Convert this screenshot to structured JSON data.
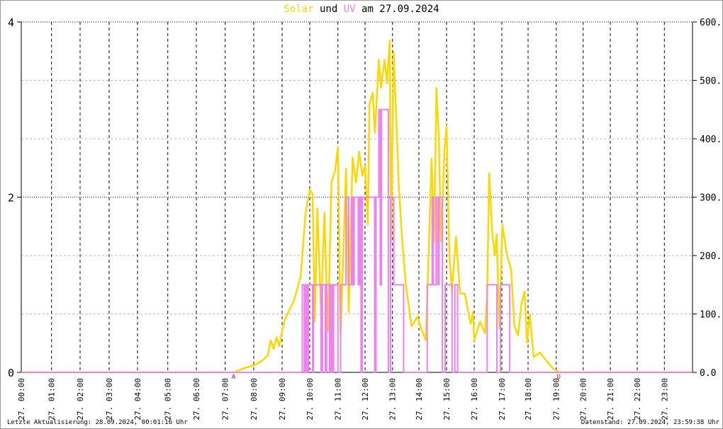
{
  "title": {
    "part1": "Solar",
    "part2": "und",
    "part3": "UV",
    "part4": "am 27.09.2024"
  },
  "footer": {
    "last_update": "Letzte Aktualisierung: 28.09.2024, 00:01:16 Uhr",
    "data_state": "Datenstand: 27.09.2024, 23:59:38 Uhr"
  },
  "colors": {
    "solar": "#FFD700",
    "uv": "#EE82EE",
    "marker": "#FF0000"
  },
  "chart_data": {
    "type": "line",
    "title": "Solar und UV am 27.09.2024",
    "x_unit": "hour of day",
    "xlim": [
      0,
      24
    ],
    "x_tick_labels": [
      "27. 00:00",
      "27. 01:00",
      "27. 02:00",
      "27. 03:00",
      "27. 04:00",
      "27. 05:00",
      "27. 06:00",
      "27. 07:00",
      "27. 08:00",
      "27. 09:00",
      "27. 10:00",
      "27. 11:00",
      "27. 12:00",
      "27. 13:00",
      "27. 14:00",
      "27. 15:00",
      "27. 16:00",
      "27. 17:00",
      "27. 18:00",
      "27. 19:00",
      "27. 20:00",
      "27. 21:00",
      "27. 22:00",
      "27. 23:00"
    ],
    "left_axis": {
      "label": "UV",
      "ylim": [
        0,
        4
      ],
      "tick_labels": [
        "4",
        "2",
        "0"
      ],
      "ticks": [
        4,
        2,
        0
      ]
    },
    "right_axis": {
      "label": "Solar",
      "ylim": [
        0,
        600
      ],
      "tick_labels": [
        "600.0",
        "500.0",
        "400.0",
        "300.0",
        "200.0",
        "100.0",
        "0.0"
      ],
      "ticks": [
        600,
        500,
        400,
        300,
        200,
        100,
        0
      ]
    },
    "grid": true,
    "markers": [
      {
        "label": "A",
        "hour": 7.3
      },
      {
        "label": "U",
        "hour": 19.1
      }
    ],
    "series": [
      {
        "name": "Solar",
        "axis": "right",
        "points": [
          [
            0,
            0
          ],
          [
            7.3,
            0
          ],
          [
            7.6,
            6
          ],
          [
            8.0,
            12
          ],
          [
            8.3,
            20
          ],
          [
            8.5,
            30
          ],
          [
            8.6,
            55
          ],
          [
            8.7,
            40
          ],
          [
            8.8,
            60
          ],
          [
            8.9,
            45
          ],
          [
            9.0,
            70
          ],
          [
            9.1,
            91
          ],
          [
            9.43,
            123
          ],
          [
            9.67,
            164
          ],
          [
            9.85,
            273
          ],
          [
            10.0,
            313
          ],
          [
            10.1,
            305
          ],
          [
            10.18,
            87
          ],
          [
            10.27,
            281
          ],
          [
            10.4,
            103
          ],
          [
            10.52,
            273
          ],
          [
            10.65,
            71
          ],
          [
            10.77,
            325
          ],
          [
            10.9,
            345
          ],
          [
            11.0,
            386
          ],
          [
            11.1,
            63
          ],
          [
            11.3,
            349
          ],
          [
            11.4,
            103
          ],
          [
            11.54,
            368
          ],
          [
            11.67,
            325
          ],
          [
            11.78,
            378
          ],
          [
            11.9,
            337
          ],
          [
            12.0,
            354
          ],
          [
            12.1,
            253
          ],
          [
            12.16,
            459
          ],
          [
            12.28,
            479
          ],
          [
            12.36,
            410
          ],
          [
            12.5,
            535
          ],
          [
            12.58,
            487
          ],
          [
            12.71,
            535
          ],
          [
            12.8,
            495
          ],
          [
            12.9,
            568
          ],
          [
            12.95,
            224
          ],
          [
            13.04,
            549
          ],
          [
            13.15,
            426
          ],
          [
            13.24,
            317
          ],
          [
            13.37,
            224
          ],
          [
            13.5,
            152
          ],
          [
            13.72,
            79
          ],
          [
            13.95,
            95
          ],
          [
            14.08,
            75
          ],
          [
            14.25,
            55
          ],
          [
            14.34,
            188
          ],
          [
            14.46,
            366
          ],
          [
            14.55,
            224
          ],
          [
            14.63,
            487
          ],
          [
            14.72,
            402
          ],
          [
            14.8,
            224
          ],
          [
            14.93,
            386
          ],
          [
            15.0,
            422
          ],
          [
            15.1,
            204
          ],
          [
            15.19,
            139
          ],
          [
            15.34,
            232
          ],
          [
            15.49,
            135
          ],
          [
            15.66,
            135
          ],
          [
            15.87,
            83
          ],
          [
            15.96,
            103
          ],
          [
            16.0,
            55
          ],
          [
            16.21,
            87
          ],
          [
            16.39,
            67
          ],
          [
            16.47,
            135
          ],
          [
            16.54,
            341
          ],
          [
            16.65,
            240
          ],
          [
            16.74,
            200
          ],
          [
            16.81,
            236
          ],
          [
            16.91,
            75
          ],
          [
            17.02,
            253
          ],
          [
            17.18,
            204
          ],
          [
            17.35,
            176
          ],
          [
            17.48,
            79
          ],
          [
            17.62,
            63
          ],
          [
            17.75,
            119
          ],
          [
            17.87,
            139
          ],
          [
            17.96,
            51
          ],
          [
            18.06,
            99
          ],
          [
            18.2,
            26
          ],
          [
            18.42,
            34
          ],
          [
            18.68,
            18
          ],
          [
            18.9,
            6
          ],
          [
            19.1,
            0
          ],
          [
            24,
            0
          ]
        ]
      },
      {
        "name": "UV",
        "axis": "left",
        "step": true,
        "points": [
          [
            0,
            0
          ],
          [
            9.73,
            1
          ],
          [
            9.8,
            0
          ],
          [
            9.85,
            1
          ],
          [
            9.9,
            0
          ],
          [
            9.95,
            1
          ],
          [
            10.1,
            0
          ],
          [
            10.13,
            1
          ],
          [
            10.4,
            0
          ],
          [
            10.45,
            1
          ],
          [
            10.55,
            0
          ],
          [
            10.6,
            1
          ],
          [
            10.7,
            0
          ],
          [
            10.75,
            1
          ],
          [
            10.8,
            0
          ],
          [
            10.85,
            1
          ],
          [
            11.0,
            0
          ],
          [
            11.1,
            1
          ],
          [
            11.3,
            2
          ],
          [
            11.4,
            1
          ],
          [
            11.5,
            2
          ],
          [
            11.55,
            1
          ],
          [
            11.6,
            2
          ],
          [
            11.75,
            1
          ],
          [
            11.8,
            2
          ],
          [
            11.85,
            0
          ],
          [
            11.9,
            2
          ],
          [
            12.35,
            0
          ],
          [
            12.4,
            2
          ],
          [
            12.5,
            3
          ],
          [
            12.55,
            1
          ],
          [
            12.6,
            3
          ],
          [
            12.85,
            0
          ],
          [
            12.93,
            2
          ],
          [
            13.05,
            1
          ],
          [
            13.42,
            0
          ],
          [
            14.3,
            1
          ],
          [
            14.48,
            2
          ],
          [
            14.52,
            1
          ],
          [
            14.62,
            2
          ],
          [
            14.68,
            1
          ],
          [
            14.73,
            2
          ],
          [
            14.85,
            0
          ],
          [
            14.95,
            1
          ],
          [
            15.2,
            0
          ],
          [
            15.3,
            1
          ],
          [
            15.4,
            0
          ],
          [
            16.47,
            1
          ],
          [
            16.82,
            0
          ],
          [
            16.95,
            1
          ],
          [
            17.3,
            0
          ],
          [
            24,
            0
          ]
        ]
      }
    ]
  }
}
